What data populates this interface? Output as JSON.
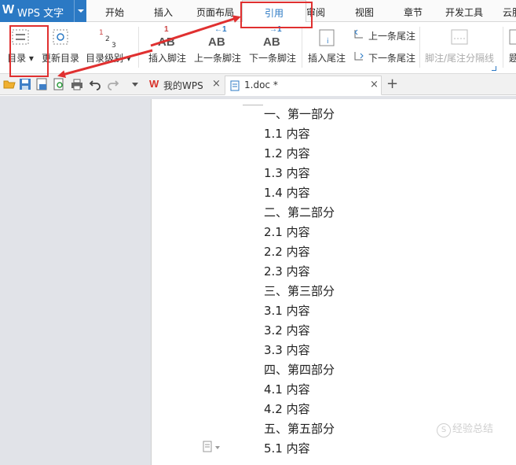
{
  "app": {
    "logo": "W",
    "title": "WPS 文字"
  },
  "menu_tabs": [
    "开始",
    "插入",
    "页面布局",
    "引用",
    "审阅",
    "视图",
    "章节",
    "开发工具",
    "云服务"
  ],
  "active_menu_tab": "引用",
  "ribbon": {
    "toc": "目录",
    "update_toc": "更新目录",
    "toc_level": "目录级别",
    "insert_footnote": "插入脚注",
    "prev_footnote": "上一条脚注",
    "next_footnote": "下一条脚注",
    "insert_endnote": "插入尾注",
    "prev_endnote": "上一条尾注",
    "next_endnote": "下一条尾注",
    "separator_line": "脚注/尾注分隔线",
    "cut_label": "题"
  },
  "tabs": [
    {
      "label": "我的WPS",
      "close": "×"
    },
    {
      "label": "1.doc *",
      "close": "×"
    }
  ],
  "new_tab": "+",
  "document_lines": [
    "一、第一部分",
    "1.1 内容",
    "1.2 内容",
    "1.3 内容",
    "1.4 内容",
    "二、第二部分",
    "2.1 内容",
    "2.2 内容",
    "2.3 内容",
    "三、第三部分",
    "3.1 内容",
    "3.2 内容",
    "3.3 内容",
    "四、第四部分",
    "4.1 内容",
    "4.2 内容",
    "五、第五部分",
    "5.1 内容"
  ],
  "watermark": "经验总结",
  "colors": {
    "accent": "#2b79c4",
    "annotation": "#e03030",
    "workspace": "#e1e3e8"
  }
}
